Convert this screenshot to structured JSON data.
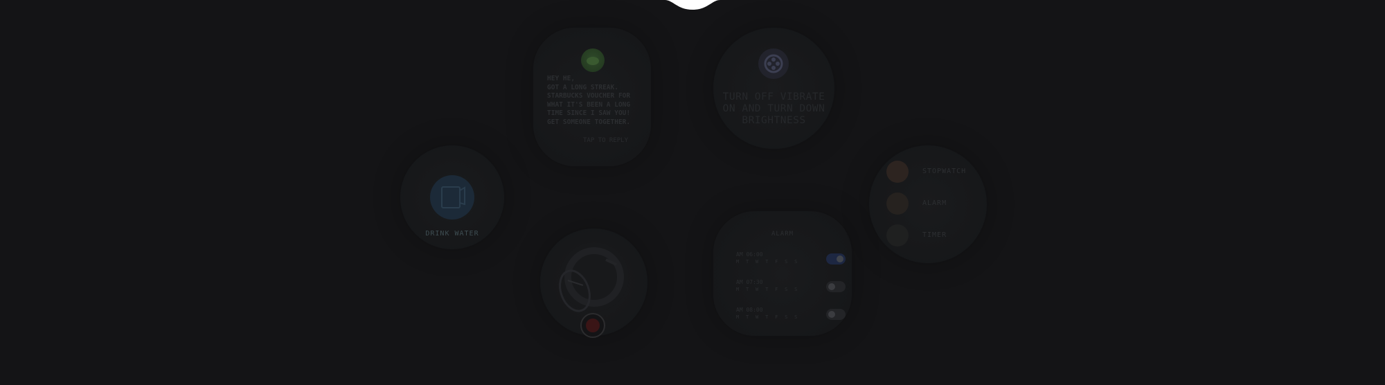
{
  "colors": {
    "background": "#141416",
    "water_accent": "#1c2a38",
    "record_accent": "#3a1516",
    "toggle_on": "#1d2742",
    "menu_stopwatch": "#2d2420",
    "menu_alarm": "#26221f",
    "menu_timer": "#1f2020"
  },
  "water": {
    "icon": "cup-icon",
    "label": "DRINK WATER"
  },
  "message": {
    "avatar_icon": "coffee-icon",
    "text": "HEY HE,\nGOT A LONG STREAK.\nSTARBUCKS VOUCHER FOR\nWHAT IT'S BEEN A LONG\nTIME SINCE I SAW YOU!\nGET SOMEONE TOGETHER.",
    "link": "TAP TO REPLY"
  },
  "power": {
    "icon": "film-reel-icon",
    "text": "TURN OFF VIBRATE\nON AND TURN DOWN\nBRIGHTNESS"
  },
  "camera": {
    "icon": "camera-lens-icon",
    "record_icon": "record-icon"
  },
  "alarm": {
    "title": "ALARM",
    "items": [
      {
        "time": "AM 06:00",
        "days": "M T W T F S S",
        "on": true
      },
      {
        "time": "AM 07:30",
        "days": "M T W T F S S",
        "on": false
      },
      {
        "time": "AM 08:00",
        "days": "M T W T F S S",
        "on": false
      }
    ]
  },
  "menu": {
    "items": [
      {
        "label": "STOPWATCH",
        "icon": "stopwatch-icon"
      },
      {
        "label": "ALARM",
        "icon": "alarm-icon"
      },
      {
        "label": "TIMER",
        "icon": "timer-icon"
      }
    ]
  }
}
